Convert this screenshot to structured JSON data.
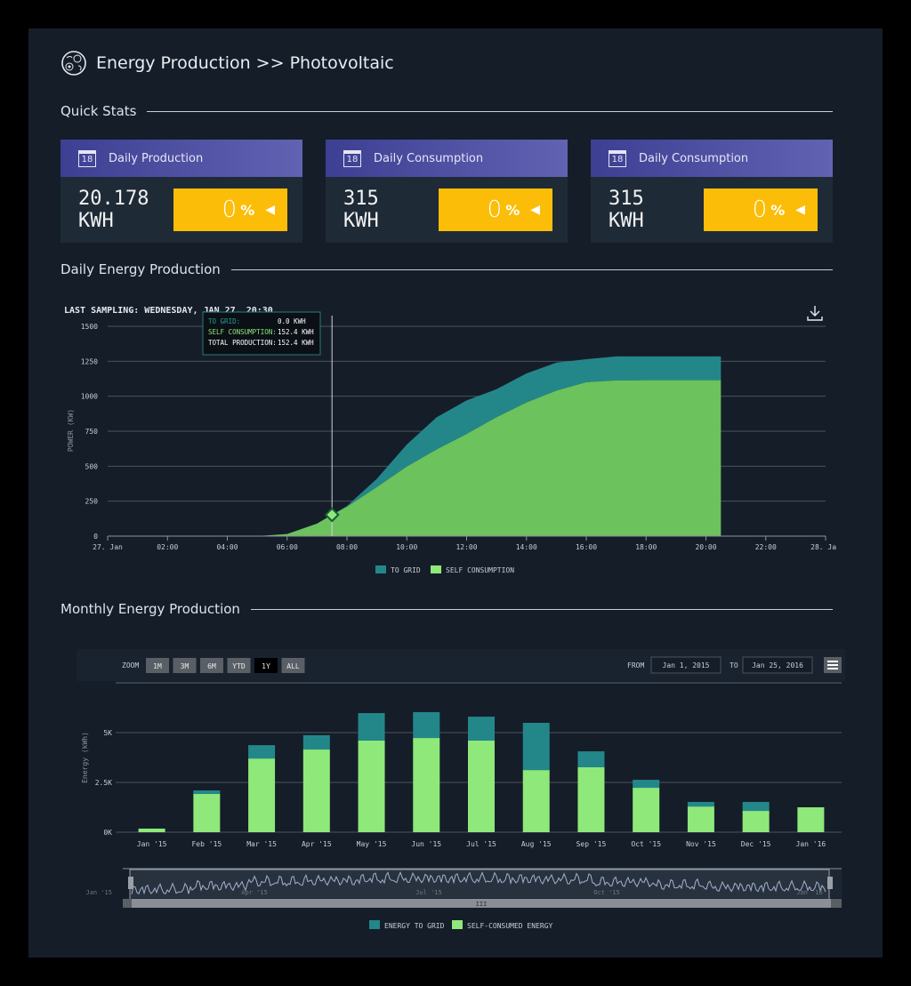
{
  "header": {
    "title": "Energy Production >> Photovoltaic",
    "icon": "pv-cells-icon"
  },
  "quick_stats": {
    "title": "Quick Stats",
    "cards": [
      {
        "label": "Daily Production",
        "value": "20.178",
        "unit": "KWH",
        "percent": "0",
        "percent_sign": "%",
        "icon": "calendar-icon",
        "calendar_day": "18"
      },
      {
        "label": "Daily Consumption",
        "value": "315",
        "unit": "KWH",
        "percent": "0",
        "percent_sign": "%",
        "icon": "calendar-icon",
        "calendar_day": "18"
      },
      {
        "label": "Daily Consumption",
        "value": "315",
        "unit": "KWH",
        "percent": "0",
        "percent_sign": "%",
        "icon": "calendar-icon",
        "calendar_day": "18"
      }
    ]
  },
  "colors": {
    "accent": "#fbbd08",
    "to_grid": "#23878a",
    "self": "#8ee87a",
    "header_grad": [
      "#3d3f92",
      "#6262b3"
    ]
  },
  "daily": {
    "title": "Daily Energy Production",
    "last_sampling": "LAST SAMPLING: WEDNESDAY, JAN 27, 20:30",
    "tooltip": {
      "to_grid_label": "TO GRID:",
      "to_grid": "0.0 KWH",
      "self_label": "SELF CONSUMPTION:",
      "self": "152.4 KWH",
      "total_label": "TOTAL PRODUCTION:",
      "total": "152.4 KWH"
    }
  },
  "monthly": {
    "title": "Monthly Energy Production",
    "zoom_label": "ZOOM",
    "zoom_buttons": [
      "1M",
      "3M",
      "6M",
      "YTD",
      "1Y",
      "ALL"
    ],
    "zoom_selected": "1Y",
    "from_label": "FROM",
    "from": "Jan 1, 2015",
    "to_label": "TO",
    "to": "Jan 25, 2016",
    "navigator_labels": [
      "Jan '15",
      "Apr '15",
      "Jul '15",
      "Oct '15",
      "Jan '16"
    ]
  },
  "chart_data": [
    {
      "type": "area",
      "stacked": true,
      "ylabel": "POWER (KW)",
      "ylim": [
        0,
        1500
      ],
      "yticks": [
        0,
        250,
        500,
        750,
        1000,
        1250,
        1500
      ],
      "xticks": [
        "27. Jan",
        "02:00",
        "04:00",
        "06:00",
        "08:00",
        "10:00",
        "12:00",
        "14:00",
        "16:00",
        "18:00",
        "20:00",
        "22:00",
        "28. Jan"
      ],
      "x_hours": [
        0,
        5,
        6,
        7,
        7.5,
        8,
        9,
        10,
        11,
        12,
        13,
        14,
        15,
        16,
        17,
        18,
        19,
        20,
        20.5
      ],
      "series": [
        {
          "name": "SELF CONSUMPTION",
          "values": [
            0,
            0,
            15,
            90,
            152.4,
            210,
            350,
            497,
            620,
            730,
            850,
            955,
            1040,
            1100,
            1113,
            1115,
            1115,
            1115,
            1115
          ]
        },
        {
          "name": "TO GRID",
          "values": [
            0,
            0,
            0,
            0,
            0,
            5,
            60,
            158,
            230,
            240,
            200,
            208,
            200,
            165,
            172,
            170,
            170,
            170,
            170
          ]
        }
      ],
      "legend": [
        "TO GRID",
        "SELF CONSUMPTION"
      ],
      "legend_position": "bottom",
      "grid": true,
      "crosshair_at": 7.5
    },
    {
      "type": "bar",
      "stacked": true,
      "ylabel": "Energy (kWh)",
      "ylim": [
        0,
        6500
      ],
      "yticks": [
        "0K",
        "2.5K",
        "5K"
      ],
      "categories": [
        "Jan '15",
        "Feb '15",
        "Mar '15",
        "Apr '15",
        "May '15",
        "Jun '15",
        "Jul '15",
        "Aug '15",
        "Sep '15",
        "Oct '15",
        "Nov '15",
        "Dec '15",
        "Jan '16"
      ],
      "series": [
        {
          "name": "SELF-CONSUMED ENERGY",
          "values": [
            180,
            1920,
            3700,
            4150,
            4600,
            4730,
            4600,
            3120,
            3260,
            2230,
            1290,
            1070,
            1250
          ]
        },
        {
          "name": "ENERGY TO GRID",
          "values": [
            0,
            180,
            670,
            720,
            1380,
            1300,
            1200,
            2370,
            800,
            400,
            230,
            450,
            0
          ]
        }
      ],
      "legend": [
        "ENERGY TO GRID",
        "SELF-CONSUMED ENERGY"
      ],
      "legend_position": "bottom",
      "grid": true
    }
  ]
}
